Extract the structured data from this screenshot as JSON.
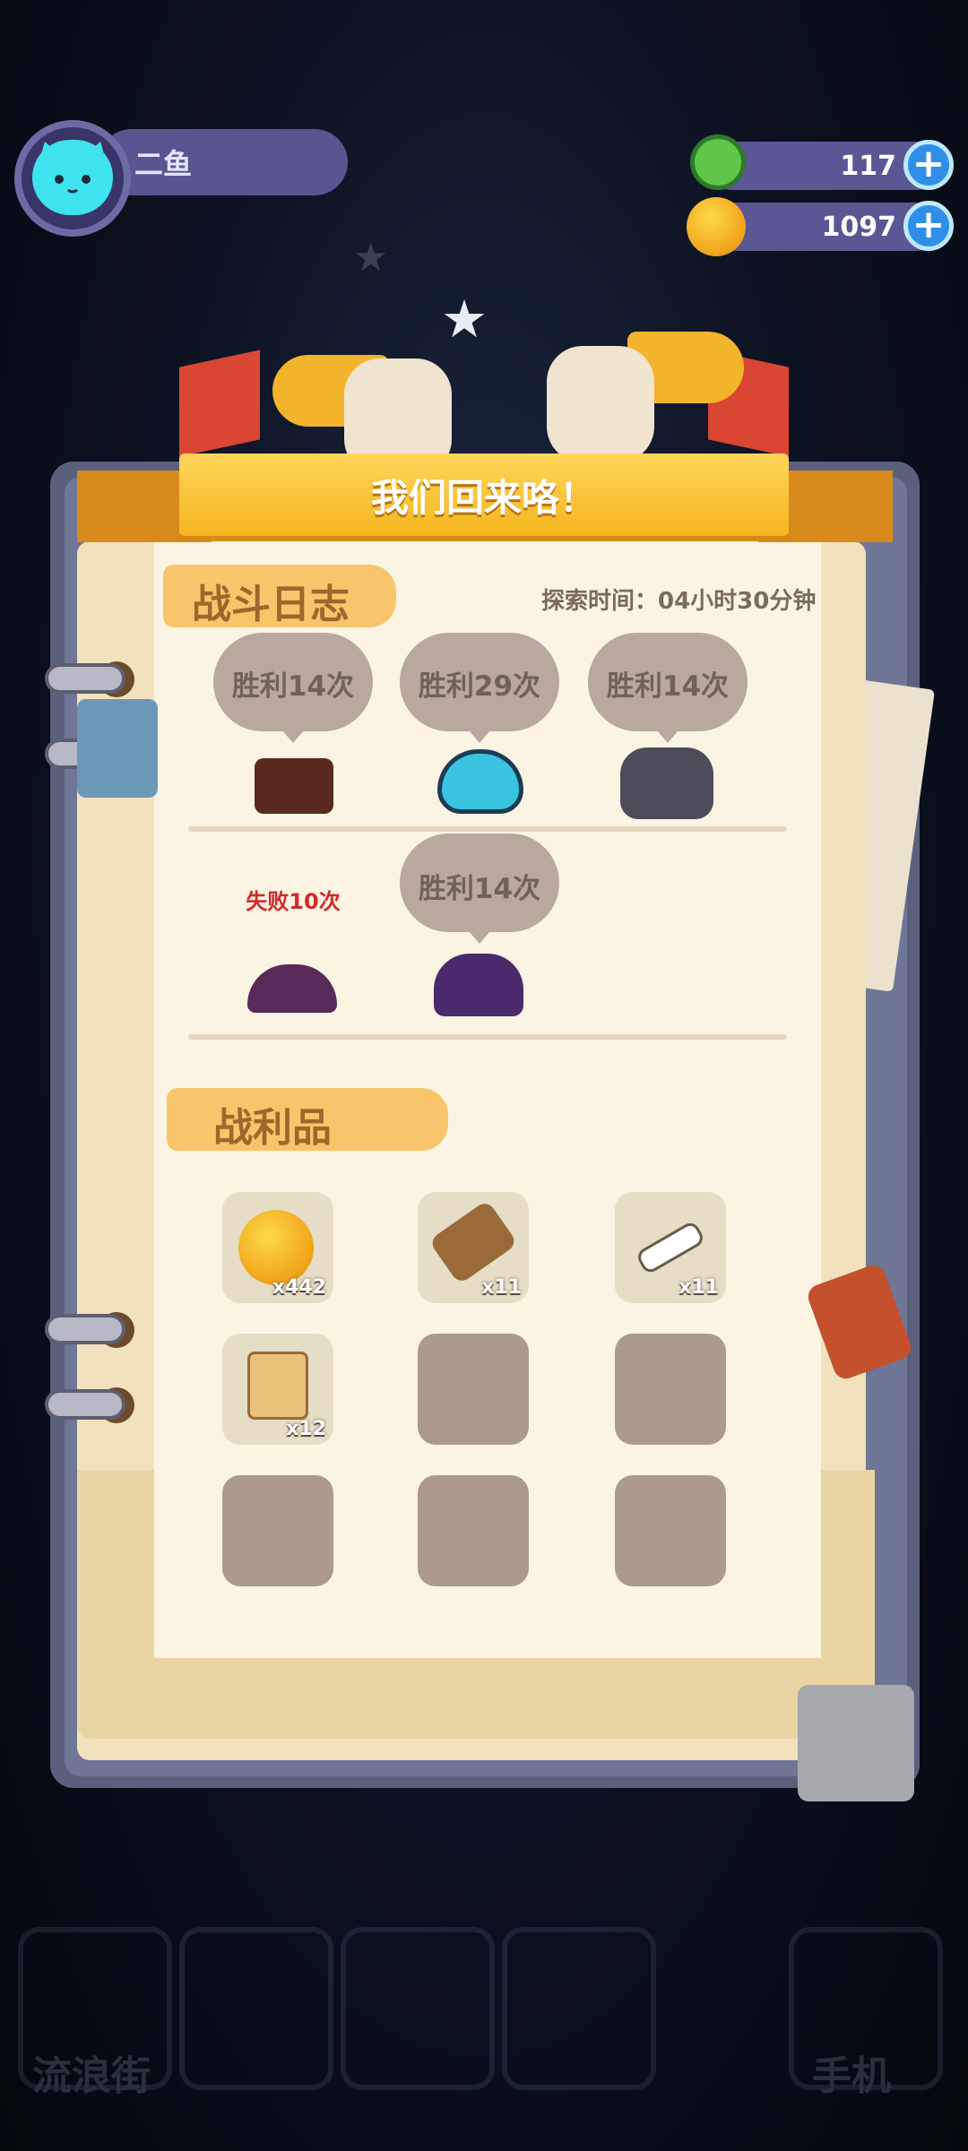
{
  "player": {
    "name": "二鱼"
  },
  "currencies": [
    {
      "id": "gem",
      "value": "117",
      "color": "#5fc64a"
    },
    {
      "id": "coin",
      "value": "1097",
      "color": "#f5b51f"
    }
  ],
  "dialog": {
    "title": "我们回来咯！",
    "battle_log": {
      "label": "战斗日志",
      "explore_time": "探索时间：04小时30分钟",
      "results": [
        {
          "text": "胜利14次",
          "outcome": "win",
          "monster": "crate-monster"
        },
        {
          "text": "胜利29次",
          "outcome": "win",
          "monster": "blue-slime"
        },
        {
          "text": "胜利14次",
          "outcome": "win",
          "monster": "grey-wolf"
        },
        {
          "text": "失败10次",
          "outcome": "lose",
          "monster": "purple-mound"
        },
        {
          "text": "胜利14次",
          "outcome": "win",
          "monster": "dark-mound"
        }
      ]
    },
    "loot": {
      "label": "战利品",
      "items": [
        {
          "icon": "gold-coin-icon",
          "qty": "x442"
        },
        {
          "icon": "wood-branch-icon",
          "qty": "x11"
        },
        {
          "icon": "bone-icon",
          "qty": "x11"
        },
        {
          "icon": "map-scroll-icon",
          "qty": "x12"
        }
      ],
      "empty_slots": 5
    }
  },
  "bottom_nav": {
    "left_label": "流浪街",
    "right_label": "手机"
  },
  "colors": {
    "accent": "#f5b51f",
    "pill": "#5a5590",
    "paper": "#fbf4e3"
  }
}
